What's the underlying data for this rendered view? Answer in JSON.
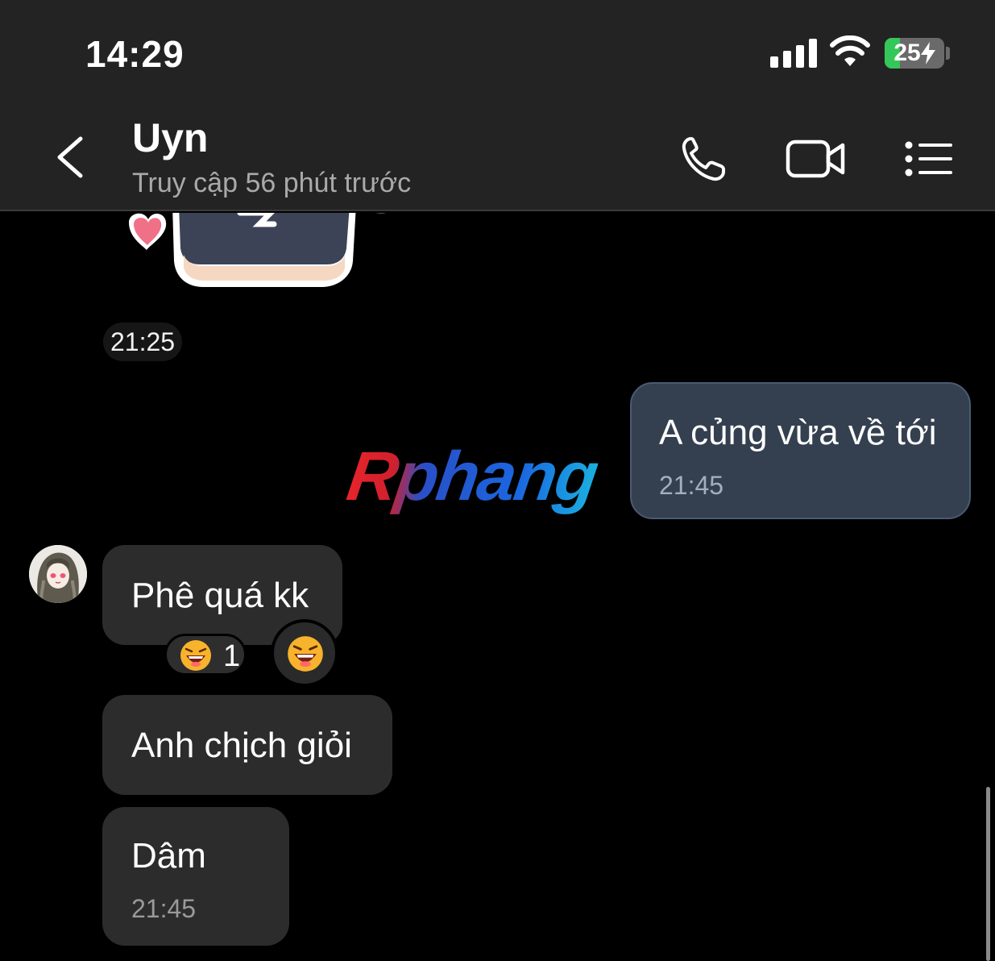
{
  "status_bar": {
    "time": "14:29",
    "battery_level": 25,
    "battery_text": "25",
    "battery_color": "#35c759",
    "icons": [
      "cellular-signal-icon",
      "wifi-icon",
      "battery-charging-icon"
    ]
  },
  "header": {
    "contact_name": "Uyn",
    "contact_status": "Truy cập 56 phút trước",
    "icons": [
      "chevron-left-icon",
      "phone-icon",
      "video-camera-icon",
      "menu-list-icon"
    ]
  },
  "chat": {
    "sticker_time": "21:25",
    "outgoing": [
      {
        "text": "A củng vừa về tới",
        "time": "21:45"
      }
    ],
    "watermark": "Rphang",
    "incoming": [
      {
        "text": "Phê quá kk",
        "time": ""
      },
      {
        "text": "Anh chịch giỏi",
        "time": ""
      },
      {
        "text": "Dâm",
        "time": "21:45"
      }
    ],
    "reaction": {
      "emoji": "laughing-face-icon",
      "count": "1"
    },
    "colors": {
      "outgoing_bubble": "#344050",
      "incoming_bubble": "#2c2c2c",
      "background": "#000000"
    }
  }
}
